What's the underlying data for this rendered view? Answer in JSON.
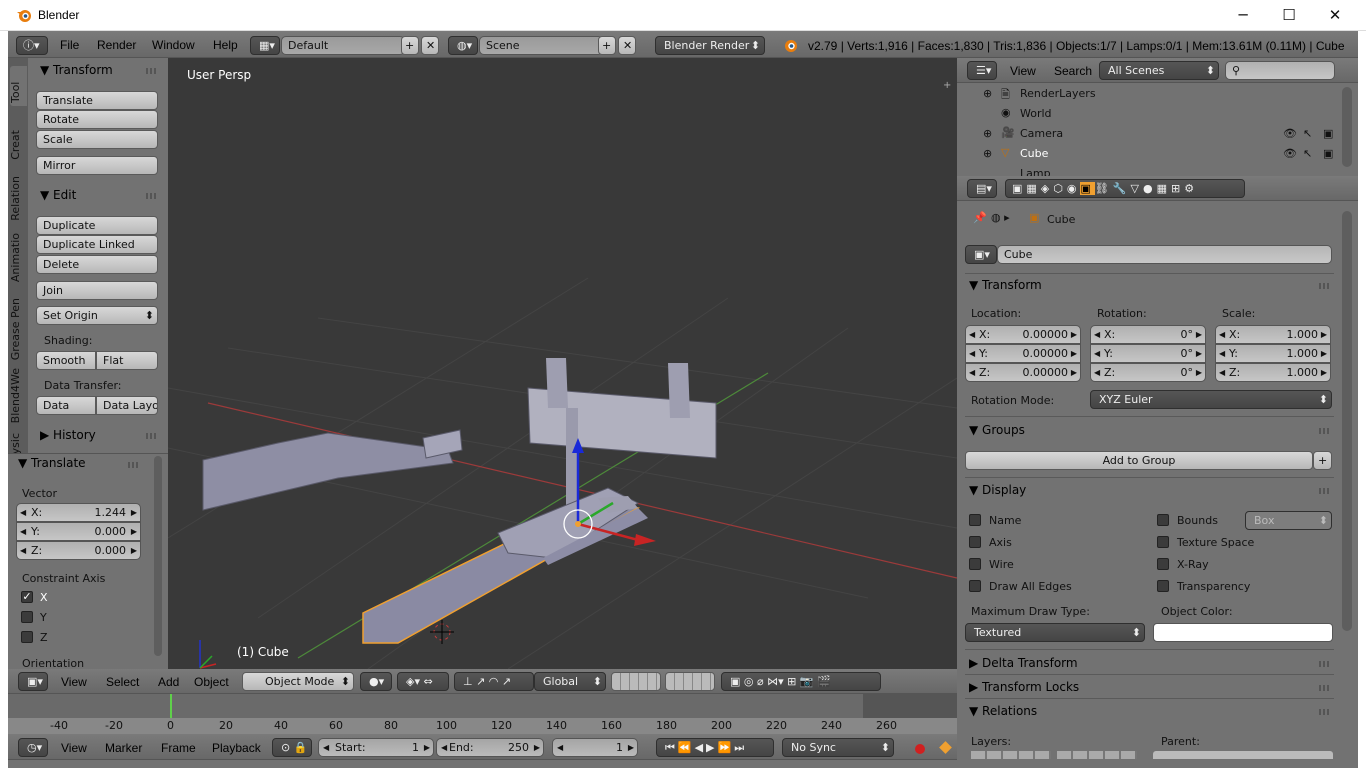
{
  "window": {
    "title": "Blender",
    "min": "─",
    "max": "☐",
    "close": "✕"
  },
  "topbar": {
    "menus": [
      "File",
      "Render",
      "Window",
      "Help"
    ],
    "layout": "Default",
    "scene": "Scene",
    "engine": "Blender Render",
    "stats": "v2.79 | Verts:1,916 | Faces:1,830 | Tris:1,836 | Objects:1/7 | Lamps:0/1 | Mem:13.61M (0.11M) | Cube"
  },
  "toolshelf": {
    "tabs": [
      "Tool",
      "Creat",
      "Relation",
      "Animatio",
      "Grease Pen",
      "Blend4We",
      "Physic"
    ],
    "transform": {
      "title": "Transform",
      "buttons": [
        "Translate",
        "Rotate",
        "Scale",
        "Mirror"
      ]
    },
    "edit": {
      "title": "Edit",
      "buttons": [
        "Duplicate",
        "Duplicate Linked",
        "Delete",
        "Join"
      ],
      "set_origin": "Set Origin",
      "shading_label": "Shading:",
      "smooth": "Smooth",
      "flat": "Flat",
      "data_transfer_label": "Data Transfer:",
      "data": "Data",
      "data_layo": "Data Layo"
    },
    "history": "History"
  },
  "operator": {
    "title": "Translate",
    "vector_label": "Vector",
    "x": "X:",
    "xv": "1.244",
    "y": "Y:",
    "yv": "0.000",
    "z": "Z:",
    "zv": "0.000",
    "constraint_label": "Constraint Axis",
    "cx": "X",
    "cy": "Y",
    "cz": "Z",
    "orientation": "Orientation"
  },
  "viewport": {
    "view_name": "User Persp",
    "object_label": "(1) Cube",
    "menus": [
      "View",
      "Select",
      "Add",
      "Object"
    ],
    "mode": "Object Mode",
    "orientation": "Global"
  },
  "timeline": {
    "ticks": [
      "-40",
      "-20",
      "0",
      "20",
      "40",
      "60",
      "80",
      "100",
      "120",
      "140",
      "160",
      "180",
      "200",
      "220",
      "240",
      "260"
    ],
    "menus": [
      "View",
      "Marker",
      "Frame",
      "Playback"
    ],
    "start_label": "Start:",
    "start": "1",
    "end_label": "End:",
    "end": "250",
    "current": "1",
    "sync": "No Sync"
  },
  "outliner": {
    "menus": [
      "View",
      "Search"
    ],
    "scenes": "All Scenes",
    "items": [
      "RenderLayers",
      "World",
      "Camera",
      "Cube",
      "Lamp"
    ]
  },
  "properties": {
    "breadcrumb": "Cube",
    "name": "Cube",
    "transform_title": "Transform",
    "location": "Location:",
    "rotation": "Rotation:",
    "scale": "Scale:",
    "loc": [
      "0.00000",
      "0.00000",
      "0.00000"
    ],
    "rot": [
      "0°",
      "0°",
      "0°"
    ],
    "scl": [
      "1.000",
      "1.000",
      "1.000"
    ],
    "axes": [
      "X:",
      "Y:",
      "Z:"
    ],
    "rot_mode_label": "Rotation Mode:",
    "rot_mode": "XYZ Euler",
    "groups_title": "Groups",
    "add_group": "Add to Group",
    "display_title": "Display",
    "display_left": [
      "Name",
      "Axis",
      "Wire",
      "Draw All Edges"
    ],
    "display_right": [
      "Bounds",
      "Texture Space",
      "X-Ray",
      "Transparency"
    ],
    "bounds_type": "Box",
    "max_draw_label": "Maximum Draw Type:",
    "max_draw": "Textured",
    "obj_color_label": "Object Color:",
    "delta": "Delta Transform",
    "locks": "Transform Locks",
    "relations": "Relations",
    "layers": "Layers:",
    "parent": "Parent:"
  },
  "colors": {
    "accent_orange": "#f0a030",
    "selected_blue": "#5680c2",
    "x_axis": "#c83c3c",
    "y_axis": "#5fa83a"
  }
}
